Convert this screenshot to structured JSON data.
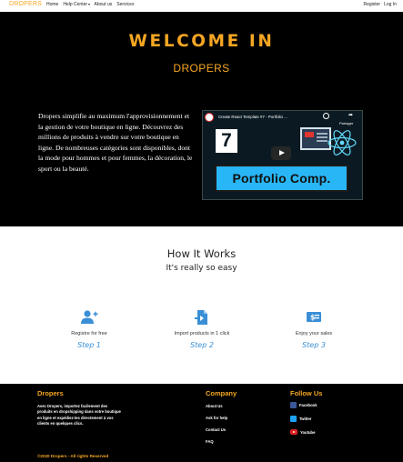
{
  "navbar": {
    "brand": "DROPERS",
    "links": [
      "Home",
      "Help Center",
      "About us",
      "Services"
    ],
    "register": "Register",
    "login": "Log In"
  },
  "hero": {
    "title": "WELCOME IN",
    "subtitle": "DROPERS",
    "description": "Dropers simplifie au maximum l'approvisionnement et la gestion de votre boutique en ligne. Découvrez des millions de produits à vendre sur votre boutique en ligne. De nombreuses catégories sont disponibles, dont la mode pour hommes et pour femmes, la décoration, le sport ou la beauté.",
    "video": {
      "title": "Create React Template #7 - Portfolio ...",
      "share_label": "Partager",
      "episode": "7",
      "banner": "Portfolio Comp."
    }
  },
  "how_it_works": {
    "title": "How It Works",
    "subtitle": "It's really so easy",
    "steps": [
      {
        "icon": "add-user-icon",
        "label": "Registre for free",
        "step": "Step 1"
      },
      {
        "icon": "import-file-icon",
        "label": "Import products in 1 click",
        "step": "Step 2"
      },
      {
        "icon": "money-icon",
        "label": "Enjoy your sales",
        "step": "Step 3"
      }
    ]
  },
  "footer": {
    "brand_title": "Dropers",
    "brand_text": "Avec Dropers, importez facilement des produits en dropshipping dans votre boutique en ligne et expédiez-les directement à vos clients en quelques clics.",
    "company_title": "Company",
    "company_links": [
      "About Us",
      "Ask for help",
      "Contact Us",
      "FAQ"
    ],
    "follow_title": "Follow Us",
    "social": [
      "Facebook",
      "Twitter",
      "Youtube"
    ],
    "copyright": "©2020 Dropers - All rights Reserved"
  },
  "colors": {
    "accent": "#f5a623",
    "hero_bg": "#000000",
    "step_blue": "#3a8fd6"
  }
}
